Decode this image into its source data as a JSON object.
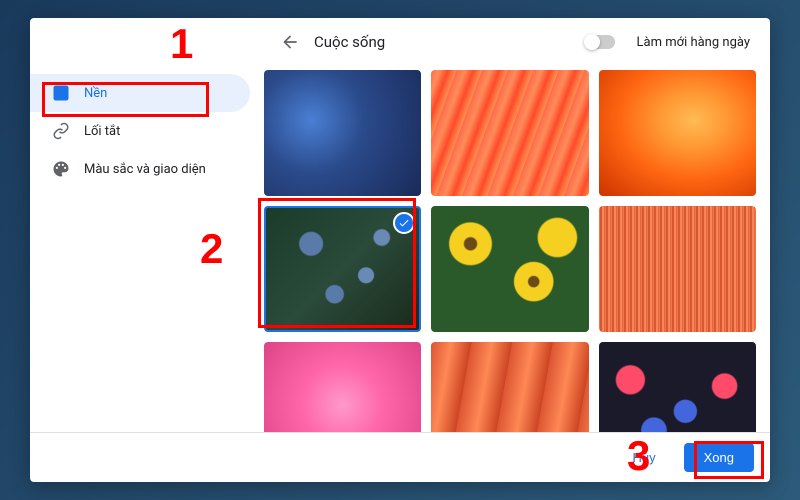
{
  "header": {
    "title": "Cuộc sống",
    "refresh_label": "Làm mới hàng ngày",
    "refresh_enabled": false
  },
  "sidebar": {
    "items": [
      {
        "label": "Nền",
        "icon": "background-icon",
        "active": true
      },
      {
        "label": "Lối tắt",
        "icon": "link-icon",
        "active": false
      },
      {
        "label": "Màu sắc và giao diện",
        "icon": "palette-icon",
        "active": false
      }
    ]
  },
  "grid": {
    "items": [
      {
        "selected": false
      },
      {
        "selected": false
      },
      {
        "selected": false
      },
      {
        "selected": true
      },
      {
        "selected": false
      },
      {
        "selected": false
      },
      {
        "selected": false
      },
      {
        "selected": false
      },
      {
        "selected": false
      }
    ]
  },
  "footer": {
    "cancel_label": "Hủy",
    "done_label": "Xong"
  },
  "annotations": {
    "n1": "1",
    "n2": "2",
    "n3": "3"
  }
}
